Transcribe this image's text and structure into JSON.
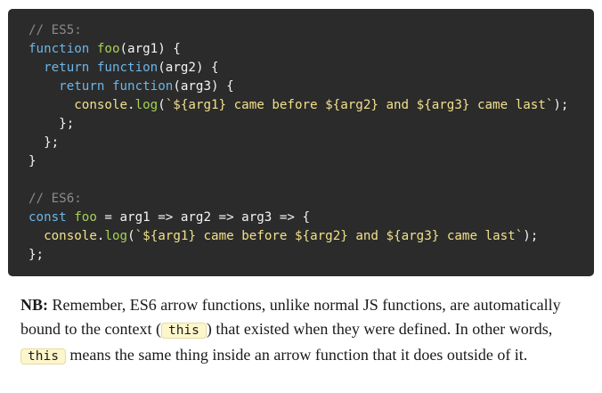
{
  "code": {
    "lines": [
      [
        {
          "t": "// ES5:",
          "c": "comment"
        }
      ],
      [
        {
          "t": "function",
          "c": "keyword"
        },
        {
          "t": " ",
          "c": "plain"
        },
        {
          "t": "foo",
          "c": "fn"
        },
        {
          "t": "(arg1) {",
          "c": "plain"
        }
      ],
      [
        {
          "t": "  ",
          "c": "plain"
        },
        {
          "t": "return",
          "c": "keyword"
        },
        {
          "t": " ",
          "c": "plain"
        },
        {
          "t": "function",
          "c": "keyword"
        },
        {
          "t": "(arg2) {",
          "c": "plain"
        }
      ],
      [
        {
          "t": "    ",
          "c": "plain"
        },
        {
          "t": "return",
          "c": "keyword"
        },
        {
          "t": " ",
          "c": "plain"
        },
        {
          "t": "function",
          "c": "keyword"
        },
        {
          "t": "(arg3) {",
          "c": "plain"
        }
      ],
      [
        {
          "t": "      ",
          "c": "plain"
        },
        {
          "t": "console",
          "c": "builtin"
        },
        {
          "t": ".",
          "c": "plain"
        },
        {
          "t": "log",
          "c": "fn"
        },
        {
          "t": "(",
          "c": "plain"
        },
        {
          "t": "`${arg1} came before ${arg2} and ${arg3} came last`",
          "c": "str"
        },
        {
          "t": ");",
          "c": "plain"
        }
      ],
      [
        {
          "t": "    };",
          "c": "plain"
        }
      ],
      [
        {
          "t": "  };",
          "c": "plain"
        }
      ],
      [
        {
          "t": "}",
          "c": "plain"
        }
      ],
      [
        {
          "t": "",
          "c": "plain"
        }
      ],
      [
        {
          "t": "// ES6:",
          "c": "comment"
        }
      ],
      [
        {
          "t": "const",
          "c": "keyword"
        },
        {
          "t": " ",
          "c": "plain"
        },
        {
          "t": "foo",
          "c": "fn"
        },
        {
          "t": " = arg1 => arg2 => arg3 => {",
          "c": "plain"
        }
      ],
      [
        {
          "t": "  ",
          "c": "plain"
        },
        {
          "t": "console",
          "c": "builtin"
        },
        {
          "t": ".",
          "c": "plain"
        },
        {
          "t": "log",
          "c": "fn"
        },
        {
          "t": "(",
          "c": "plain"
        },
        {
          "t": "`${arg1} came before ${arg2} and ${arg3} came last`",
          "c": "str"
        },
        {
          "t": ");",
          "c": "plain"
        }
      ],
      [
        {
          "t": "};",
          "c": "plain"
        }
      ]
    ]
  },
  "note": {
    "label": "NB:",
    "text_1": " Remember, ES6 arrow functions, unlike normal JS functions, are automatically bound to the context (",
    "code_1": "this",
    "text_2": ") that existed when they were defined. In other words, ",
    "code_2": "this",
    "text_3": " means the same thing inside an arrow function that it does outside of it."
  },
  "colors": {
    "code_background": "#2b2b2b",
    "comment": "#8a8a8a",
    "keyword": "#6cb6e8",
    "function_name": "#a6d252",
    "string": "#f1e08a",
    "inline_code_background": "#fdf6cc"
  }
}
